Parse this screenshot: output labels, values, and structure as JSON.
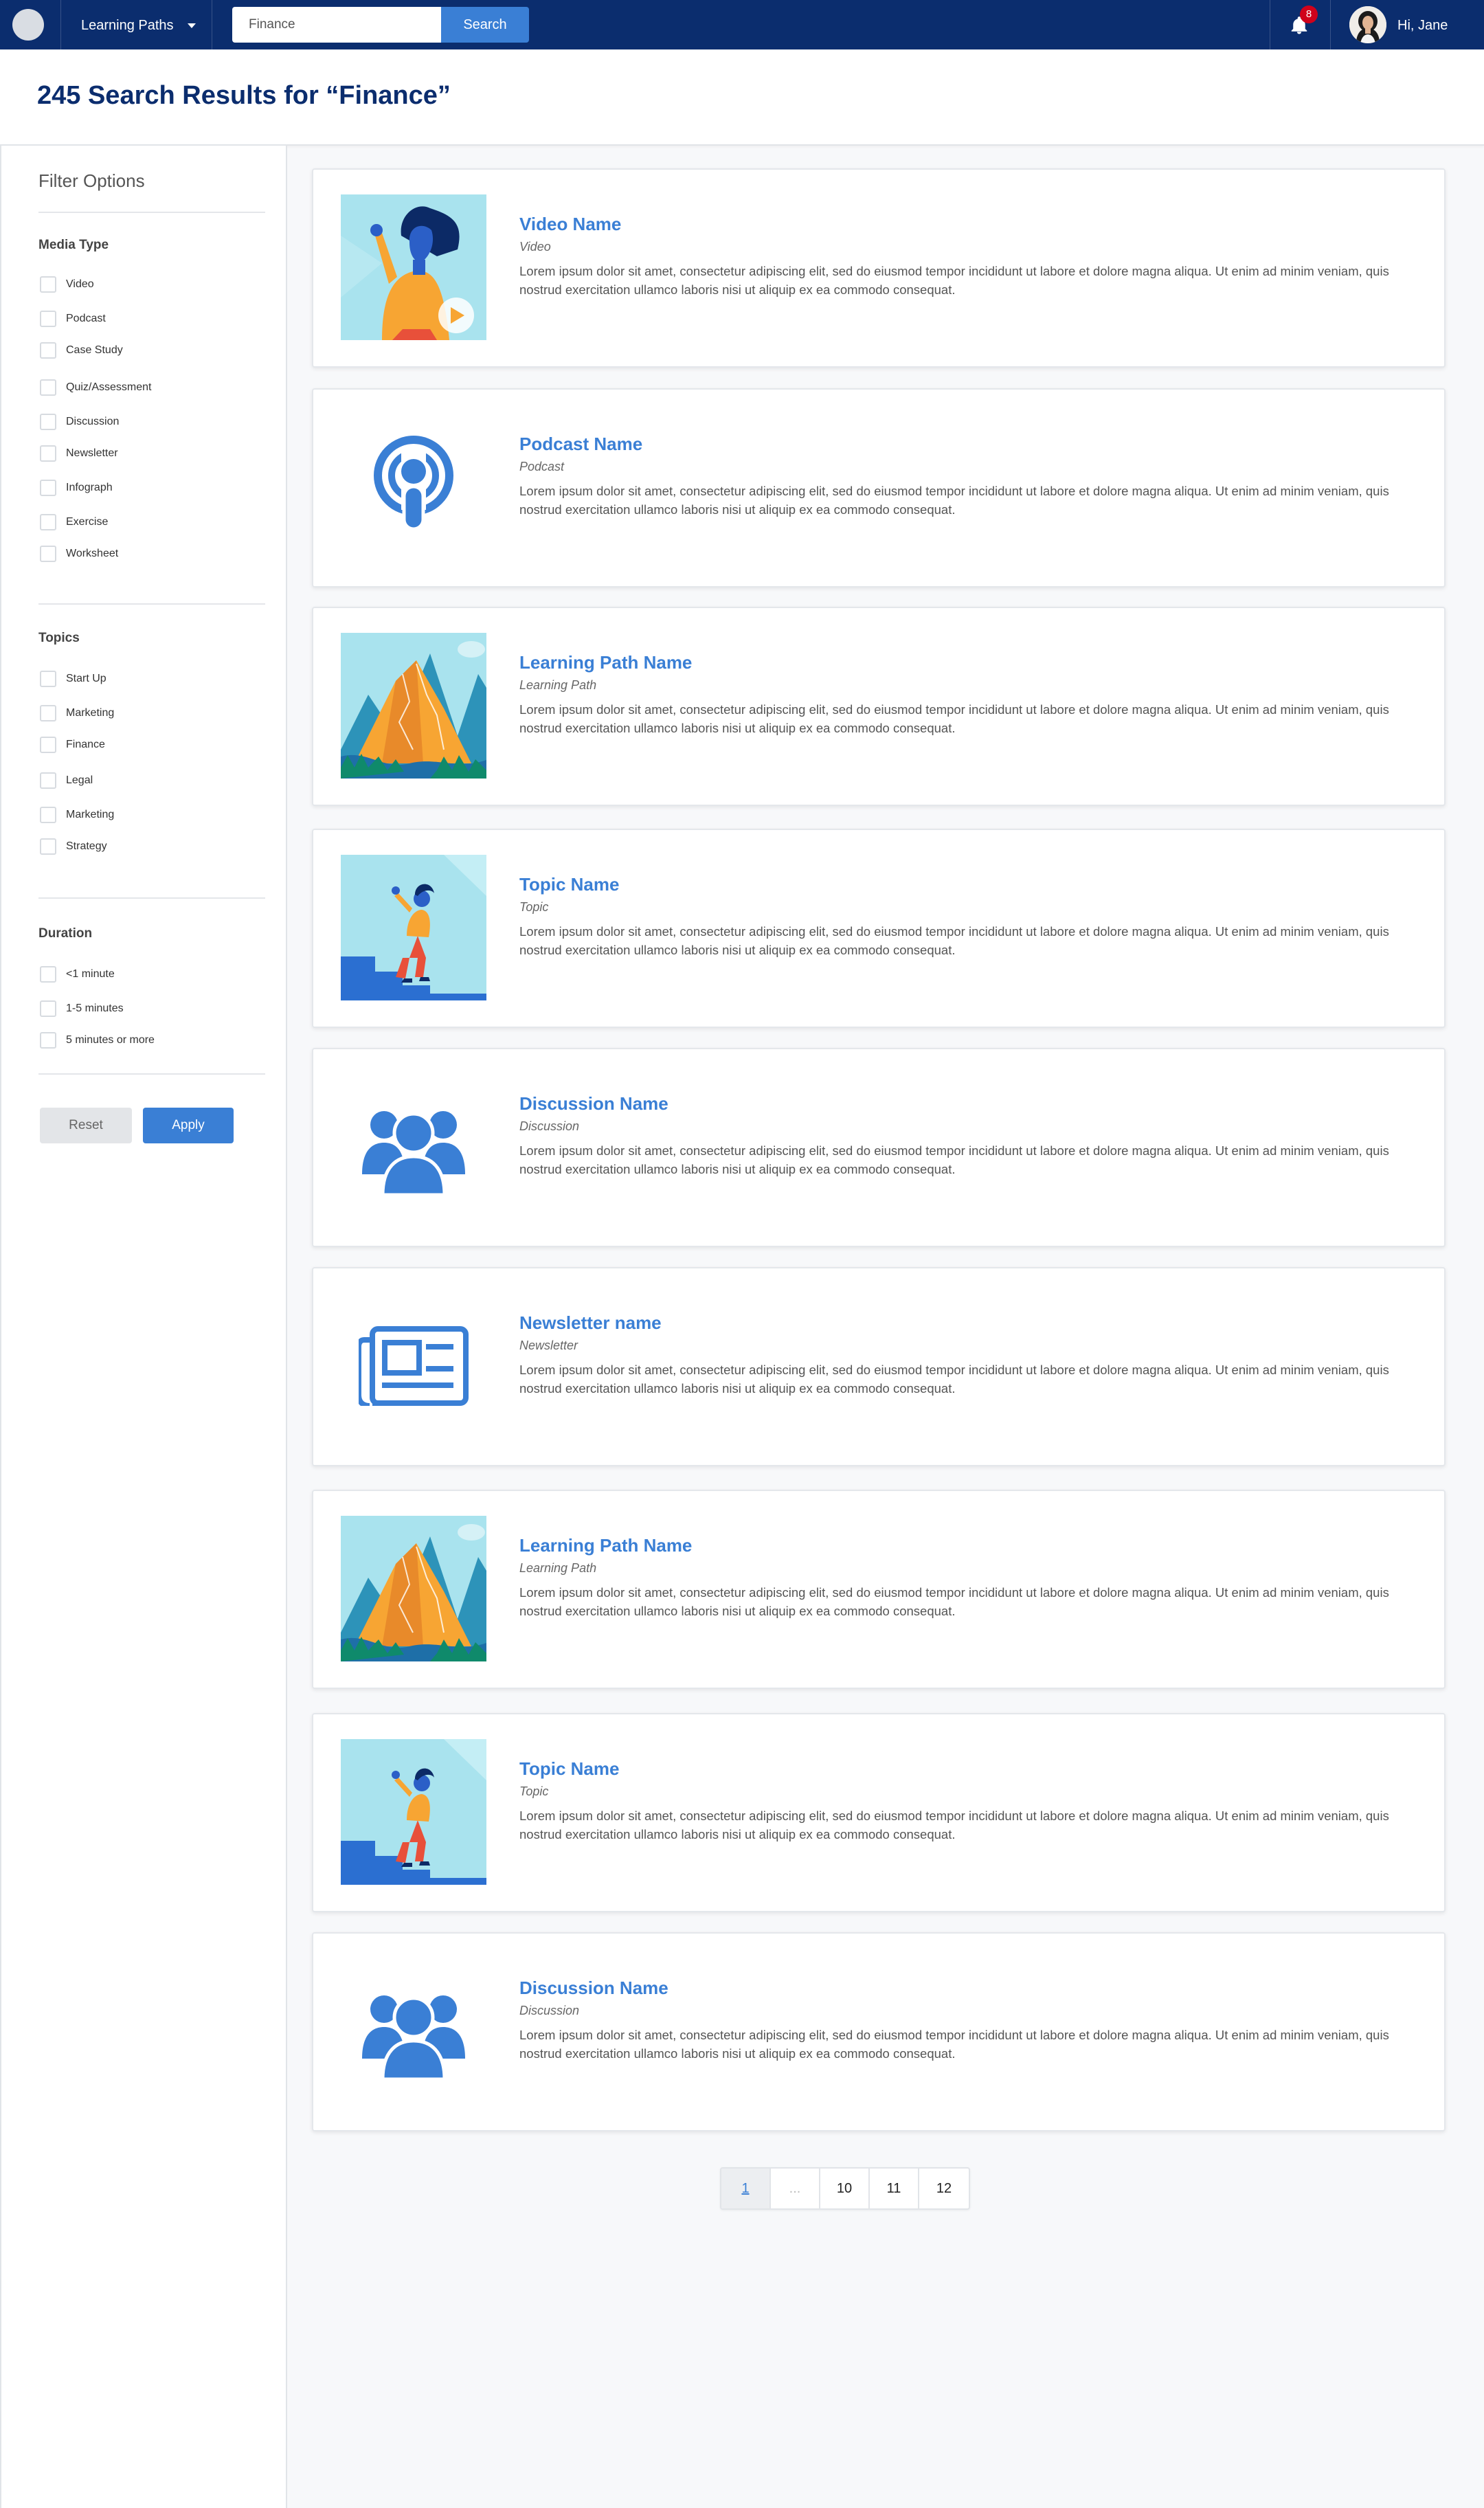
{
  "topbar": {
    "nav_menu_label": "Learning Paths",
    "search": {
      "value": "Finance",
      "button_label": "Search"
    },
    "notifications_count": "8",
    "greeting": "Hi, Jane"
  },
  "header": {
    "title": "245 Search Results for “Finance”"
  },
  "filters": {
    "title": "Filter Options",
    "media_type": {
      "title": "Media Type",
      "options": [
        "Video",
        "Podcast",
        "Case Study",
        "Quiz/Assessment",
        "Discussion",
        "Newsletter",
        "Infograph",
        "Exercise",
        "Worksheet"
      ]
    },
    "topics": {
      "title": "Topics",
      "options": [
        "Start Up",
        "Marketing",
        "Finance",
        "Legal",
        "Marketing",
        "Strategy"
      ]
    },
    "duration": {
      "title": "Duration",
      "options": [
        "<1 minute",
        "1-5 minutes",
        "5 minutes or more"
      ]
    },
    "reset_label": "Reset",
    "apply_label": "Apply"
  },
  "results": [
    {
      "title": "Video Name",
      "type": "Video",
      "icon": "video-thumbnail",
      "desc": "Lorem ipsum dolor sit amet, consectetur adipiscing elit, sed do eiusmod tempor incididunt ut labore et dolore magna aliqua. Ut enim ad minim veniam, quis nostrud exercitation ullamco laboris nisi ut aliquip ex ea commodo consequat."
    },
    {
      "title": "Podcast Name",
      "type": "Podcast",
      "icon": "podcast-icon",
      "desc": "Lorem ipsum dolor sit amet, consectetur adipiscing elit, sed do eiusmod tempor incididunt ut labore et dolore magna aliqua. Ut enim ad minim veniam, quis nostrud exercitation ullamco laboris nisi ut aliquip ex ea commodo consequat."
    },
    {
      "title": "Learning Path Name",
      "type": "Learning Path",
      "icon": "mountain-thumbnail",
      "desc": "Lorem ipsum dolor sit amet, consectetur adipiscing elit, sed do eiusmod tempor incididunt ut labore et dolore magna aliqua. Ut enim ad minim veniam, quis nostrud exercitation ullamco laboris nisi ut aliquip ex ea commodo consequat."
    },
    {
      "title": "Topic Name",
      "type": "Topic",
      "icon": "stairs-thumbnail",
      "desc": "Lorem ipsum dolor sit amet, consectetur adipiscing elit, sed do eiusmod tempor incididunt ut labore et dolore magna aliqua. Ut enim ad minim veniam, quis nostrud exercitation ullamco laboris nisi ut aliquip ex ea commodo consequat."
    },
    {
      "title": "Discussion Name",
      "type": "Discussion",
      "icon": "group-icon",
      "desc": "Lorem ipsum dolor sit amet, consectetur adipiscing elit, sed do eiusmod tempor incididunt ut labore et dolore magna aliqua. Ut enim ad minim veniam, quis nostrud exercitation ullamco laboris nisi ut aliquip ex ea commodo consequat."
    },
    {
      "title": "Newsletter name",
      "type": "Newsletter",
      "icon": "newspaper-icon",
      "desc": "Lorem ipsum dolor sit amet, consectetur adipiscing elit, sed do eiusmod tempor incididunt ut labore et dolore magna aliqua. Ut enim ad minim veniam, quis nostrud exercitation ullamco laboris nisi ut aliquip ex ea commodo consequat."
    },
    {
      "title": "Learning Path Name",
      "type": "Learning Path",
      "icon": "mountain-thumbnail",
      "desc": "Lorem ipsum dolor sit amet, consectetur adipiscing elit, sed do eiusmod tempor incididunt ut labore et dolore magna aliqua. Ut enim ad minim veniam, quis nostrud exercitation ullamco laboris nisi ut aliquip ex ea commodo consequat."
    },
    {
      "title": "Topic Name",
      "type": "Topic",
      "icon": "stairs-thumbnail",
      "desc": "Lorem ipsum dolor sit amet, consectetur adipiscing elit, sed do eiusmod tempor incididunt ut labore et dolore magna aliqua. Ut enim ad minim veniam, quis nostrud exercitation ullamco laboris nisi ut aliquip ex ea commodo consequat."
    },
    {
      "title": "Discussion Name",
      "type": "Discussion",
      "icon": "group-icon",
      "desc": "Lorem ipsum dolor sit amet, consectetur adipiscing elit, sed do eiusmod tempor incididunt ut labore et dolore magna aliqua. Ut enim ad minim veniam, quis nostrud exercitation ullamco laboris nisi ut aliquip ex ea commodo consequat."
    }
  ],
  "pagination": {
    "pages": [
      "1",
      "...",
      "10",
      "11",
      "12"
    ],
    "current": "1"
  },
  "colors": {
    "navy": "#0b2d6e",
    "accent": "#3a7fd5",
    "badge": "#d0021b"
  }
}
